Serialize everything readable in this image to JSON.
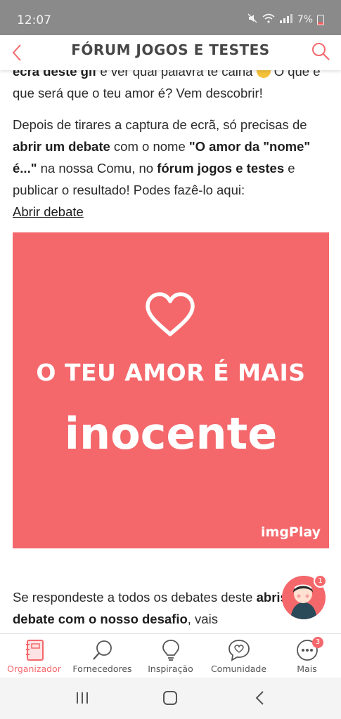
{
  "status_bar": {
    "time": "12:07",
    "battery": "7%"
  },
  "header": {
    "title": "FÓRUM JOGOS E TESTES"
  },
  "intro": {
    "bold_start": "ecrã deste gif",
    "text_a": " e ver qual palavra te calha ",
    "text_b": " O que é que será que o teu amor é? Vem descobrir!"
  },
  "instructions": {
    "t1": "Depois de tirares a captura de ecrã, só precisas de ",
    "b1": "abrir um debate",
    "t2": " com o nome ",
    "b2": "\"O amor da \"nome\" é...\"",
    "t3": " na nossa Comu, no ",
    "b3": "fórum jogos e testes",
    "t4": " e publicar o resultado! Podes fazê-lo aqui: ",
    "link": "Abrir debate"
  },
  "banner": {
    "line1": "O TEU AMOR É MAIS",
    "line2": "inocente",
    "watermark": "imgPlay",
    "color": "#f4686c"
  },
  "closing": {
    "t1": "Se respondeste a todos os debates deste ",
    "b1": "abriste o debate com o nosso desafio",
    "t2": ", vais"
  },
  "floating_avatar": {
    "badge": "1"
  },
  "bottom_nav": [
    {
      "label": "Organizador",
      "icon": "planner-icon",
      "active": true
    },
    {
      "label": "Fornecedores",
      "icon": "search-icon"
    },
    {
      "label": "Inspiração",
      "icon": "lightbulb-icon"
    },
    {
      "label": "Comunidade",
      "icon": "chat-heart-icon"
    },
    {
      "label": "Mais",
      "icon": "more-icon",
      "badge": "3"
    }
  ],
  "colors": {
    "accent": "#f4686c",
    "status_bar": "#8a8a8a"
  }
}
